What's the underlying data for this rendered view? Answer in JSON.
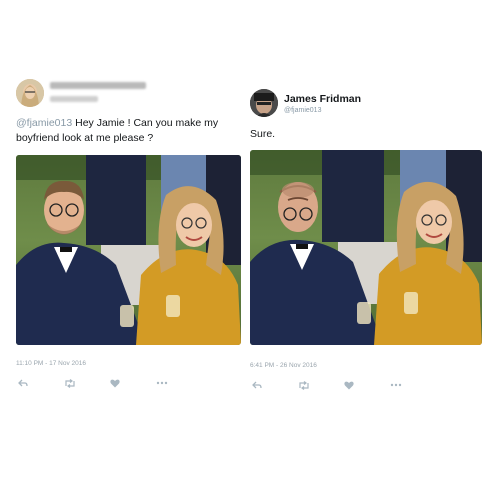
{
  "left_tweet": {
    "mention": "@fjamie013",
    "text": " Hey Jamie ! Can you make my boyfriend look at me please ?",
    "timestamp": "11:10 PM - 17 Nov 2016"
  },
  "right_tweet": {
    "author_name": "James Fridman",
    "author_handle": "@fjamie013",
    "text": "Sure.",
    "timestamp": "6:41 PM - 26 Nov 2016"
  },
  "icons": {
    "reply": "reply-icon",
    "retweet": "retweet-icon",
    "like": "heart-icon",
    "more": "more-icon"
  },
  "colors": {
    "muted": "#8899a6",
    "text": "#14171a",
    "icon": "#aab8c2"
  }
}
